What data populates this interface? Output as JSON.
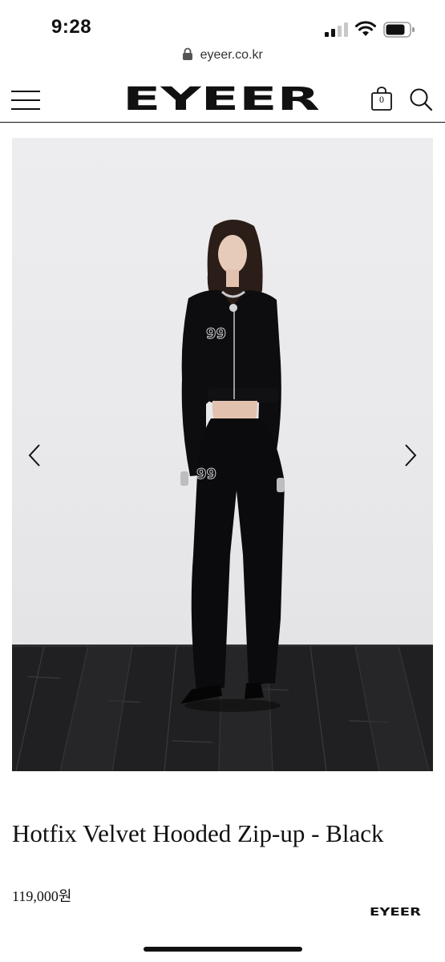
{
  "status_bar": {
    "time": "9:28",
    "signal_icon": "cellular-signal-icon",
    "wifi_icon": "wifi-icon",
    "battery_icon": "battery-icon"
  },
  "browser": {
    "url": "eyeer.co.kr",
    "lock_icon": "lock-icon"
  },
  "header": {
    "menu_icon": "hamburger-menu-icon",
    "logo_text": "EYEER",
    "cart_count": "0",
    "cart_icon": "shopping-bag-icon",
    "search_icon": "search-icon"
  },
  "gallery": {
    "prev_icon": "chevron-left-icon",
    "next_icon": "chevron-right-icon"
  },
  "product": {
    "title": "Hotfix Velvet Hooded Zip-up - Black",
    "price": "119,000원"
  },
  "footer": {
    "brand": "EYEER"
  },
  "colors": {
    "text": "#111111",
    "background": "#ffffff",
    "floor": "#1e1e1f",
    "wall": "#ebebed"
  }
}
